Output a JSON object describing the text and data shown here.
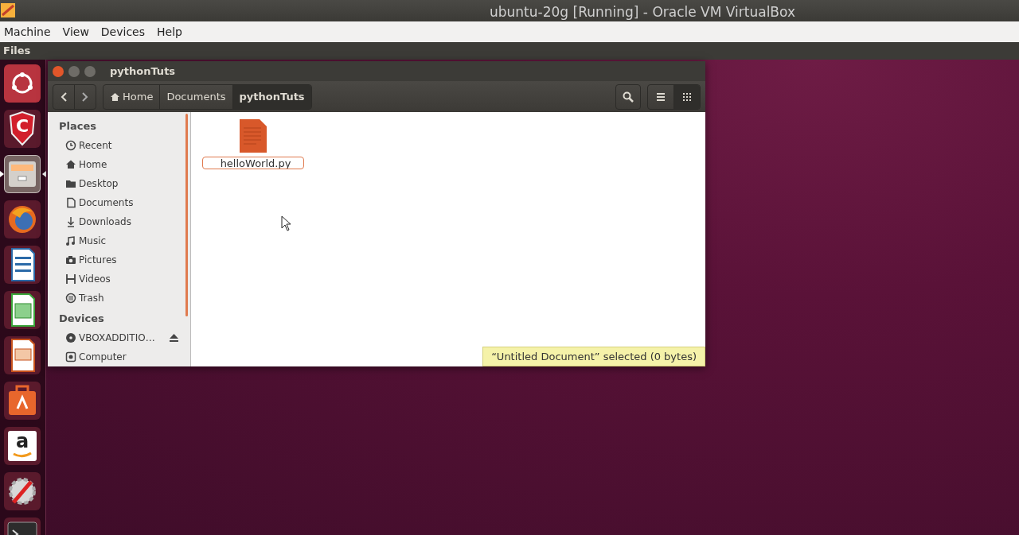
{
  "host_window": {
    "title": "ubuntu-20g [Running] - Oracle VM VirtualBox"
  },
  "host_menu": [
    "Machine",
    "View",
    "Devices",
    "Help"
  ],
  "top_panel": {
    "app_name": "Files"
  },
  "launcher": [
    {
      "kind": "dash",
      "active": false
    },
    {
      "kind": "shield",
      "active": false,
      "glyph": "C"
    },
    {
      "kind": "files",
      "active": true
    },
    {
      "kind": "browser",
      "active": false
    },
    {
      "kind": "writer",
      "active": false
    },
    {
      "kind": "calc",
      "active": false
    },
    {
      "kind": "impress",
      "active": false
    },
    {
      "kind": "store",
      "active": false
    },
    {
      "kind": "amazon",
      "active": false,
      "glyph": "a"
    },
    {
      "kind": "settings",
      "active": false
    },
    {
      "kind": "terminal",
      "active": false
    }
  ],
  "window": {
    "title": "pythonTuts",
    "breadcrumbs": [
      {
        "label": "Home",
        "selected": false
      },
      {
        "label": "Documents",
        "selected": false
      },
      {
        "label": "pythonTuts",
        "selected": true
      }
    ],
    "view_modes": [
      {
        "kind": "list",
        "selected": false
      },
      {
        "kind": "grid",
        "selected": true
      }
    ],
    "sidebar": [
      {
        "heading": "Places",
        "items": [
          {
            "label": "Recent"
          },
          {
            "label": "Home"
          },
          {
            "label": "Desktop"
          },
          {
            "label": "Documents"
          },
          {
            "label": "Downloads"
          },
          {
            "label": "Music"
          },
          {
            "label": "Pictures"
          },
          {
            "label": "Videos"
          },
          {
            "label": "Trash"
          }
        ]
      },
      {
        "heading": "Devices",
        "items": [
          {
            "label": "VBOXADDITIO…",
            "ejectable": true
          },
          {
            "label": "Computer",
            "ejectable": false
          }
        ]
      }
    ],
    "files": [
      {
        "name": "helloWorld.py",
        "renaming": true
      }
    ],
    "status": "“Untitled Document” selected  (0 bytes)"
  }
}
